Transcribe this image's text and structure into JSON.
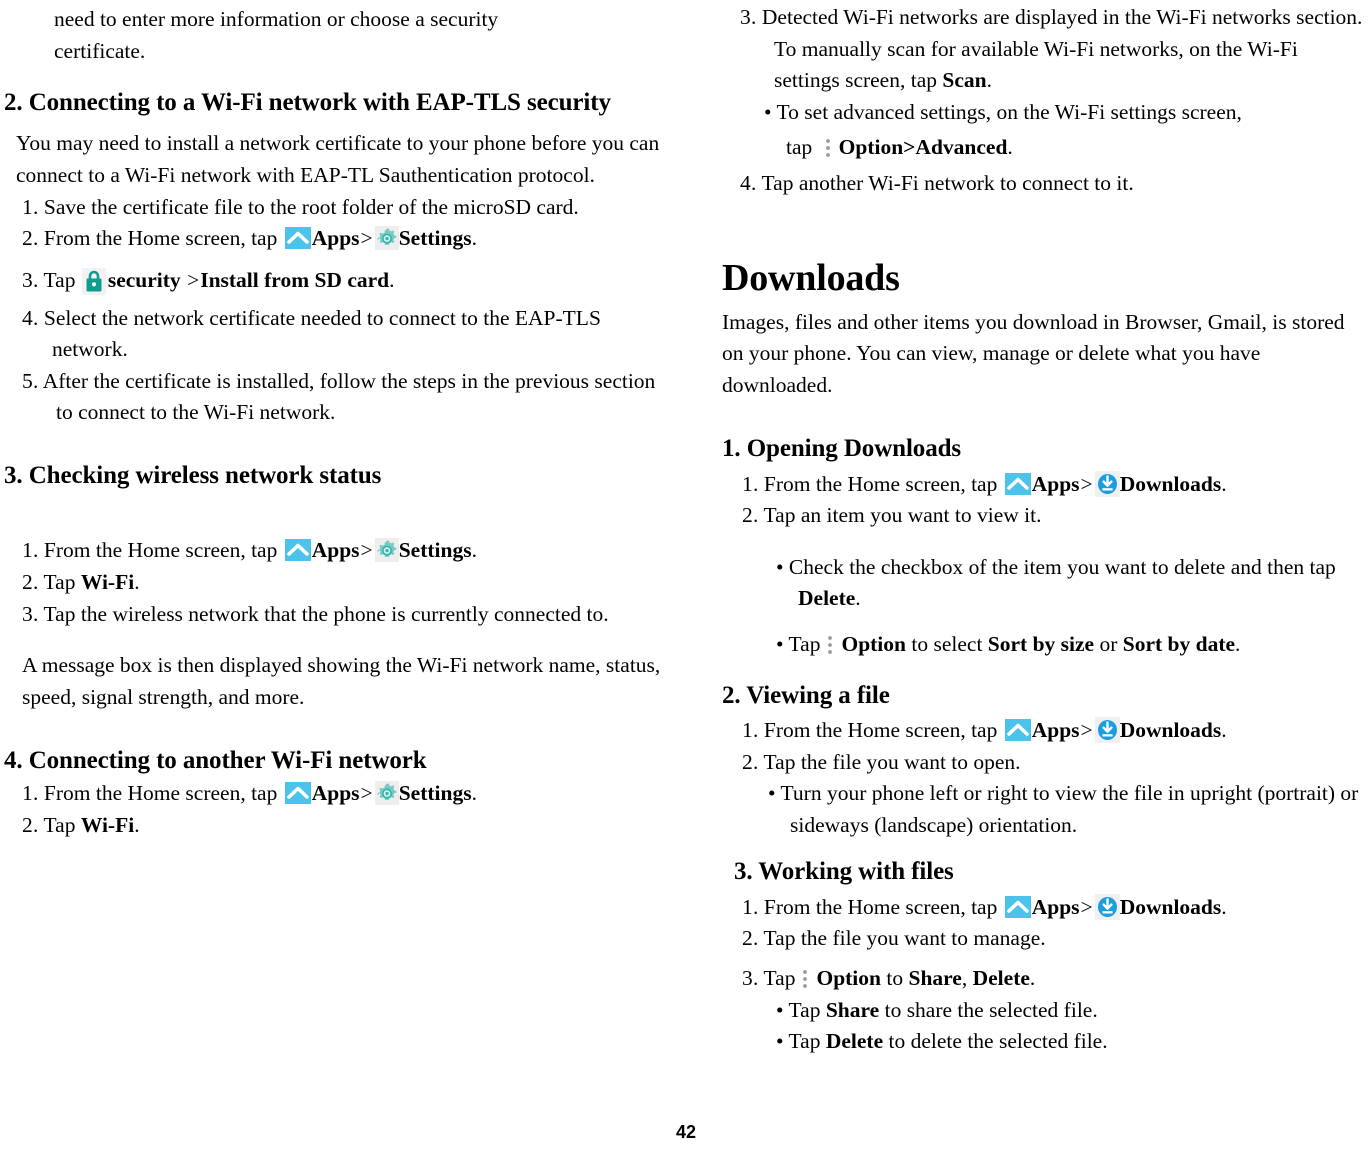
{
  "page": {
    "folio": "42",
    "colors": {
      "apps_icon_bg": "#4cc3ea",
      "settings_icon": "#6fd3cf",
      "lock_icon": "#0f9d8f",
      "download_icon": "#1a9ee0",
      "option_icon": "#9a9a9a",
      "text": "#000000",
      "background": "#ffffff"
    }
  },
  "left_column": {
    "continued_text": {
      "line1": "need to enter more information or choose a security",
      "line2": "certificate."
    },
    "section2": {
      "heading": "2. Connecting to a Wi-Fi network with EAP-TLS security",
      "intro": "You may need to install a network certificate to your phone before you can connect to a Wi-Fi network with EAP-TL Sauthentication protocol.",
      "steps": [
        {
          "num": "1.",
          "text": "Save the certificate file to the root folder of the microSD card."
        },
        {
          "num": "2.",
          "pre": "From the Home screen, tap",
          "icon1": "apps-icon",
          "bold1": "Apps",
          "sep": ">",
          "icon2": "settings-icon",
          "bold2": "Settings",
          "post": "."
        },
        {
          "num": "3.",
          "pre": "Tap",
          "icon1": "lock-icon",
          "bold1": "security",
          "sep": ">",
          "bold2": "Install from SD card",
          "post": "."
        },
        {
          "num": "4.",
          "text": "Select the network certificate needed to connect to the EAP-TLS network."
        },
        {
          "num": "5.",
          "text": "After the certificate is installed, follow the steps in the previous section to connect to the Wi-Fi network."
        }
      ]
    },
    "section3": {
      "heading": "3. Checking wireless network status",
      "steps": [
        {
          "num": "1.",
          "pre": "From the Home screen, tap",
          "icon1": "apps-icon",
          "bold1": "Apps",
          "sep": ">",
          "icon2": "settings-icon",
          "bold2": "Settings",
          "post": "."
        },
        {
          "num": "2.",
          "pre": "Tap",
          "bold1": "Wi-Fi",
          "post": "."
        },
        {
          "num": "3.",
          "text": "Tap the wireless network that the phone is currently connected to."
        }
      ],
      "note": "A message box is then displayed showing the Wi-Fi network name, status, speed, signal strength, and more."
    },
    "section4": {
      "heading": "4. Connecting to another Wi-Fi network",
      "steps": [
        {
          "num": "1.",
          "pre": "From the Home screen, tap",
          "icon1": "apps-icon",
          "bold1": "Apps",
          "sep": ">",
          "icon2": "settings-icon",
          "bold2": "Settings",
          "post": "."
        },
        {
          "num": "2.",
          "pre": "Tap",
          "bold1": "Wi-Fi",
          "post": "."
        }
      ]
    }
  },
  "right_column": {
    "continued_steps": {
      "step3": {
        "num": "3.",
        "pre": "Detected Wi-Fi networks are displayed in the Wi-Fi networks section. To manually scan for available Wi-Fi networks, on the Wi-Fi settings screen, tap",
        "bold1": "Scan",
        "post": "."
      },
      "bullet1": {
        "line1": "To set advanced settings, on the Wi-Fi settings screen,",
        "pre2": "tap",
        "icon": "option-icon",
        "bold1": "Option>Advanced",
        "post": "."
      },
      "step4": {
        "num": "4.",
        "text": "Tap another Wi-Fi network to connect to it."
      }
    },
    "downloads": {
      "title": "Downloads",
      "intro": "Images, files and other items you download in Browser, Gmail, is stored on your phone. You can view, manage or delete what you have downloaded.",
      "section1": {
        "heading": "1. Opening Downloads",
        "steps": [
          {
            "num": "1.",
            "pre": "From the Home screen, tap",
            "icon1": "apps-icon",
            "bold1": "Apps",
            "sep": ">",
            "icon2": "download-icon",
            "bold2": "Downloads",
            "post": "."
          },
          {
            "num": "2.",
            "text": "Tap an item you want to view it."
          }
        ],
        "bullets": [
          {
            "pre": "Check the checkbox of the item you want to delete and then tap",
            "bold1": "Delete",
            "post": "."
          },
          {
            "pre": "Tap",
            "icon": "option-icon",
            "bold1": "Option",
            "mid1": "to select",
            "bold2": "Sort by size",
            "mid2": "or",
            "bold3": "Sort by date",
            "post": "."
          }
        ]
      },
      "section2": {
        "heading": "2. Viewing a file",
        "steps": [
          {
            "num": "1.",
            "pre": "From the Home screen, tap",
            "icon1": "apps-icon",
            "bold1": "Apps",
            "sep": ">",
            "icon2": "download-icon",
            "bold2": "Downloads",
            "post": "."
          },
          {
            "num": "2.",
            "text": "Tap the file you want to open."
          }
        ],
        "bullets": [
          {
            "text": "Turn your phone left or right to view the file in upright (portrait) or sideways (landscape) orientation."
          }
        ]
      },
      "section3": {
        "heading": "3. Working with files",
        "steps": [
          {
            "num": "1.",
            "pre": "From the Home screen, tap",
            "icon1": "apps-icon",
            "bold1": "Apps",
            "sep": ">",
            "icon2": "download-icon",
            "bold2": "Downloads",
            "post": "."
          },
          {
            "num": "2.",
            "text": "Tap the file you want to manage."
          },
          {
            "num": "3.",
            "pre": "Tap",
            "icon": "option-icon",
            "bold1": "Option",
            "mid1": "to",
            "bold2": "Share",
            "mid2": ",",
            "bold3": "Delete",
            "post": "."
          }
        ],
        "bullets": [
          {
            "pre": "Tap",
            "bold1": "Share",
            "post": "to share the selected file."
          },
          {
            "pre": "Tap",
            "bold1": "Delete",
            "post": "to delete the selected file."
          }
        ]
      }
    }
  }
}
